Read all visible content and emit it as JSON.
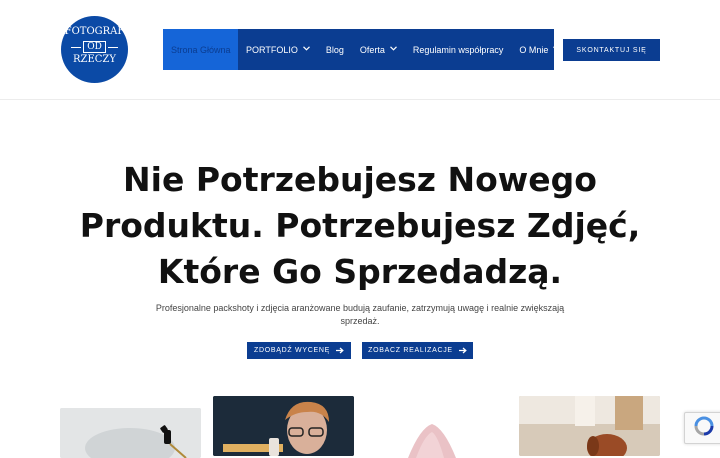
{
  "logo": {
    "line1": "FOTOGRAF",
    "line2": "OD",
    "line3": "RZECZY"
  },
  "nav": {
    "items": [
      {
        "label": "Strona Główna",
        "has_dropdown": false,
        "active": true
      },
      {
        "label": "PORTFOLIO",
        "has_dropdown": true
      },
      {
        "label": "Blog",
        "has_dropdown": false
      },
      {
        "label": "Oferta",
        "has_dropdown": true
      },
      {
        "label": "Regulamin współpracy",
        "has_dropdown": false
      },
      {
        "label": "O Mnie",
        "has_dropdown": true
      }
    ],
    "chevron": "⌄",
    "contact_label": "SKONTAKTUJ SIĘ"
  },
  "hero": {
    "title_line1": "Nie Potrzebujesz Nowego",
    "title_line2": "Produktu. Potrzebujesz Zdjęć,",
    "title_line3": "Które Go Sprzedadzą.",
    "subtitle": "Profesjonalne packshoty i zdjęcia aranżowane budują zaufanie, zatrzymują uwagę i realnie zwiększają sprzedaż.",
    "cta_primary": "ZDOBĄDŹ WYCENĘ",
    "cta_secondary": "ZOBACZ REALIZACJE",
    "arrow": "➔"
  },
  "colors": {
    "brand_dark": "#0b3d91",
    "brand_active": "#1565d8",
    "logo_bg": "#0b4aa6"
  },
  "icons": {
    "arrow": "arrow-right-icon",
    "chevron": "chevron-down-icon",
    "recaptcha": "recaptcha-icon"
  }
}
